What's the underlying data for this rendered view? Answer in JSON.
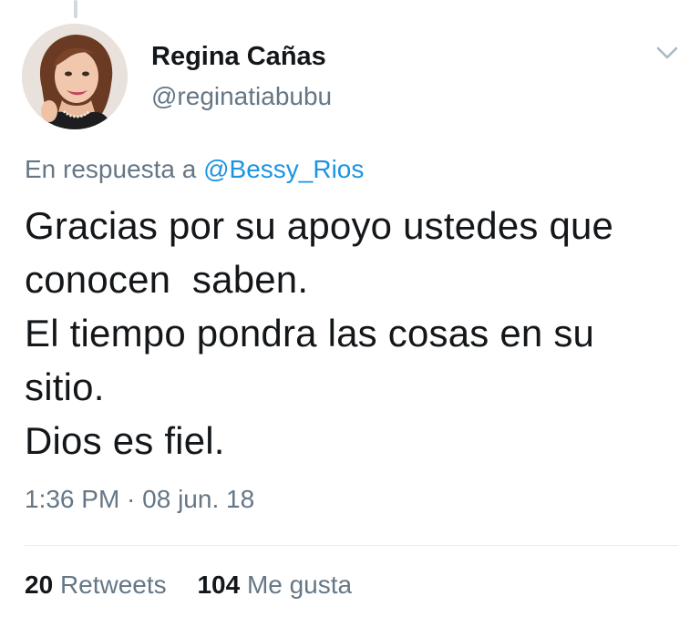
{
  "author": {
    "display_name": "Regina Cañas",
    "handle": "@reginatiabubu"
  },
  "reply": {
    "prefix": "En respuesta a",
    "to": "@Bessy_Rios"
  },
  "tweet": {
    "text": "Gracias por su apoyo ustedes que\nconocen  saben.\nEl tiempo pondra las cosas en su\nsitio.\nDios es fiel.",
    "timestamp": "1:36 PM · 08 jun. 18"
  },
  "stats": {
    "retweets_count": "20",
    "retweets_label": "Retweets",
    "likes_count": "104",
    "likes_label": "Me gusta"
  },
  "icons": {
    "menu": "chevron-down-icon"
  },
  "colors": {
    "link": "#1b95e0",
    "secondary_text": "#657786",
    "primary_text": "#14171a"
  }
}
